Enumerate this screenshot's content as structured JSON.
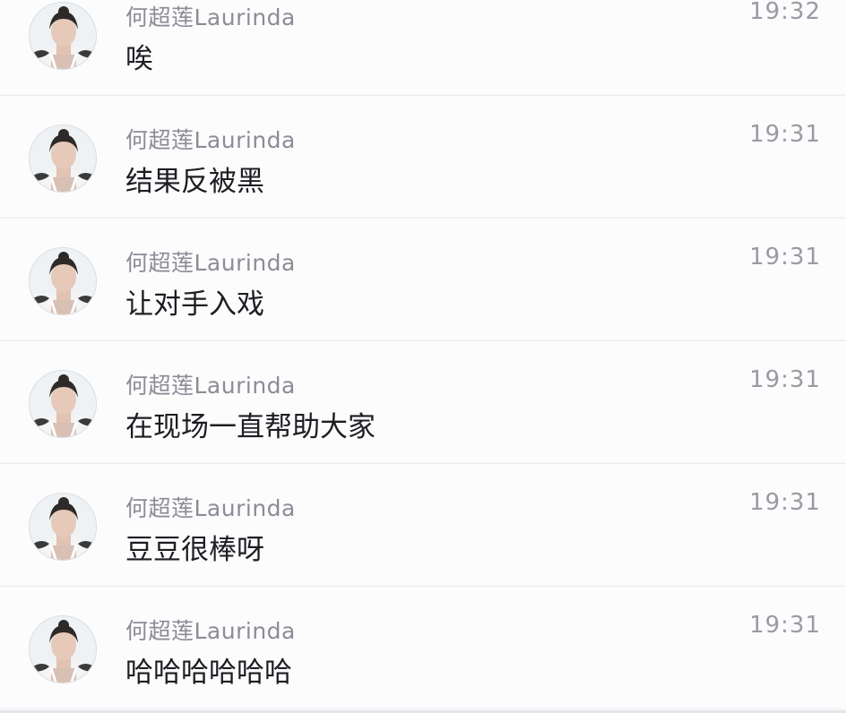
{
  "messages": [
    {
      "sender": "何超莲Laurinda",
      "time": "19:32",
      "text": "唉"
    },
    {
      "sender": "何超莲Laurinda",
      "time": "19:31",
      "text": "结果反被黑"
    },
    {
      "sender": "何超莲Laurinda",
      "time": "19:31",
      "text": "让对手入戏"
    },
    {
      "sender": "何超莲Laurinda",
      "time": "19:31",
      "text": "在现场一直帮助大家"
    },
    {
      "sender": "何超莲Laurinda",
      "time": "19:31",
      "text": "豆豆很棒呀"
    },
    {
      "sender": "何超莲Laurinda",
      "time": "19:31",
      "text": "哈哈哈哈哈哈"
    }
  ],
  "avatar_icon": "user-avatar-photo"
}
